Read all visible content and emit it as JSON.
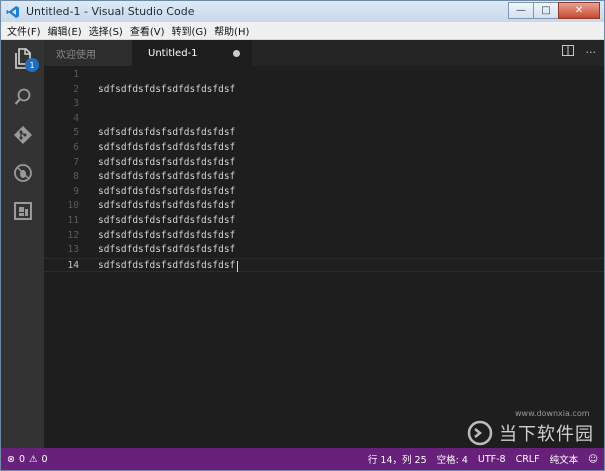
{
  "window": {
    "title": "Untitled-1 - Visual Studio Code",
    "controls": {
      "minimize": "—",
      "maximize": "□",
      "close": "✕"
    }
  },
  "menu": [
    "文件(F)",
    "编辑(E)",
    "选择(S)",
    "查看(V)",
    "转到(G)",
    "帮助(H)"
  ],
  "activity_bar": {
    "items": [
      "explorer-icon",
      "search-icon",
      "git-icon",
      "debug-icon",
      "extensions-icon"
    ],
    "explorer_badge": "1"
  },
  "tabs": [
    {
      "label": "欢迎使用",
      "active": false
    },
    {
      "label": "Untitled-1",
      "active": true,
      "dirty": true
    }
  ],
  "editor": {
    "lines": [
      {
        "n": "1",
        "text": ""
      },
      {
        "n": "2",
        "text": "sdfsdfdsfdsfsdfdsfdsfdsf"
      },
      {
        "n": "3",
        "text": ""
      },
      {
        "n": "4",
        "text": ""
      },
      {
        "n": "5",
        "text": "sdfsdfdsfdsfsdfdsfdsfdsf"
      },
      {
        "n": "6",
        "text": "sdfsdfdsfdsfsdfdsfdsfdsf"
      },
      {
        "n": "7",
        "text": "sdfsdfdsfdsfsdfdsfdsfdsf"
      },
      {
        "n": "8",
        "text": "sdfsdfdsfdsfsdfdsfdsfdsf"
      },
      {
        "n": "9",
        "text": "sdfsdfdsfdsfsdfdsfdsfdsf"
      },
      {
        "n": "10",
        "text": "sdfsdfdsfdsfsdfdsfdsfdsf"
      },
      {
        "n": "11",
        "text": "sdfsdfdsfdsfsdfdsfdsfdsf"
      },
      {
        "n": "12",
        "text": "sdfsdfdsfdsfsdfdsfdsfdsf"
      },
      {
        "n": "13",
        "text": "sdfsdfdsfdsfsdfdsfdsfdsf"
      },
      {
        "n": "14",
        "text": "sdfsdfdsfdsfsdfdsfdsfdsf"
      }
    ]
  },
  "status": {
    "errors": "0",
    "warnings": "0",
    "position": "行 14，列 25",
    "indent": "空格: 4",
    "encoding": "UTF-8",
    "eol": "CRLF",
    "language": "纯文本"
  },
  "watermark": {
    "text": "当下软件园",
    "url": "www.downxia.com"
  },
  "colors": {
    "statusbar": "#68217a",
    "editor_bg": "#1e1e1e",
    "activity_bg": "#333333",
    "badge": "#1e6fc4"
  }
}
